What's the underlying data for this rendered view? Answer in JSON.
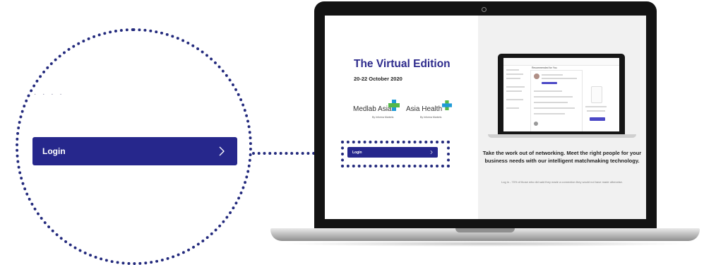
{
  "callout": {
    "login_label": "Login",
    "faded_text": "· · · ·"
  },
  "screen": {
    "left": {
      "title": "The Virtual Edition",
      "date": "20-22 October 2020",
      "logos": [
        {
          "name": "Medlab Asia",
          "by": "By Informa Markets"
        },
        {
          "name": "Asia Health",
          "by": "By Informa Markets"
        }
      ],
      "login_label": "Login"
    },
    "right": {
      "mini_screen_title": "Recommended for You",
      "tagline": "Take the work out of networking. Meet the right people for your business needs with our intelligent matchmaking technology.",
      "subtext": "Log in - 70% of those who did said they made a connection they would not have made otherwise."
    }
  },
  "colors": {
    "brand": "#26278c",
    "dots": "#232a7d",
    "logo_green": "#54b848",
    "logo_blue": "#1e9ad6"
  },
  "icons": [
    "chevron-right-icon",
    "medical-cross-icon"
  ]
}
